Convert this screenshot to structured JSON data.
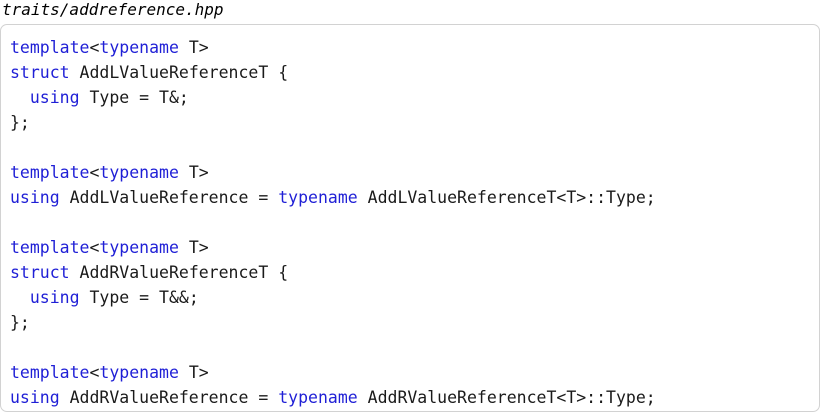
{
  "file_title": "traits/addreference.hpp",
  "colors": {
    "keyword": "#1f1fd6",
    "text": "#1a1a1a",
    "border": "#d2d2d2"
  },
  "code_lines": [
    [
      {
        "t": "kw",
        "v": "template"
      },
      {
        "t": "txt",
        "v": "<"
      },
      {
        "t": "kw",
        "v": "typename"
      },
      {
        "t": "txt",
        "v": " T>"
      }
    ],
    [
      {
        "t": "kw",
        "v": "struct"
      },
      {
        "t": "txt",
        "v": " AddLValueReferenceT {"
      }
    ],
    [
      {
        "t": "txt",
        "v": "  "
      },
      {
        "t": "kw",
        "v": "using"
      },
      {
        "t": "txt",
        "v": " Type = T&;"
      }
    ],
    [
      {
        "t": "txt",
        "v": "};"
      }
    ],
    [],
    [
      {
        "t": "kw",
        "v": "template"
      },
      {
        "t": "txt",
        "v": "<"
      },
      {
        "t": "kw",
        "v": "typename"
      },
      {
        "t": "txt",
        "v": " T>"
      }
    ],
    [
      {
        "t": "kw",
        "v": "using"
      },
      {
        "t": "txt",
        "v": " AddLValueReference = "
      },
      {
        "t": "kw",
        "v": "typename"
      },
      {
        "t": "txt",
        "v": " AddLValueReferenceT<T>::Type;"
      }
    ],
    [],
    [
      {
        "t": "kw",
        "v": "template"
      },
      {
        "t": "txt",
        "v": "<"
      },
      {
        "t": "kw",
        "v": "typename"
      },
      {
        "t": "txt",
        "v": " T>"
      }
    ],
    [
      {
        "t": "kw",
        "v": "struct"
      },
      {
        "t": "txt",
        "v": " AddRValueReferenceT {"
      }
    ],
    [
      {
        "t": "txt",
        "v": "  "
      },
      {
        "t": "kw",
        "v": "using"
      },
      {
        "t": "txt",
        "v": " Type = T&&;"
      }
    ],
    [
      {
        "t": "txt",
        "v": "};"
      }
    ],
    [],
    [
      {
        "t": "kw",
        "v": "template"
      },
      {
        "t": "txt",
        "v": "<"
      },
      {
        "t": "kw",
        "v": "typename"
      },
      {
        "t": "txt",
        "v": " T>"
      }
    ],
    [
      {
        "t": "kw",
        "v": "using"
      },
      {
        "t": "txt",
        "v": " AddRValueReference = "
      },
      {
        "t": "kw",
        "v": "typename"
      },
      {
        "t": "txt",
        "v": " AddRValueReferenceT<T>::Type;"
      }
    ]
  ]
}
